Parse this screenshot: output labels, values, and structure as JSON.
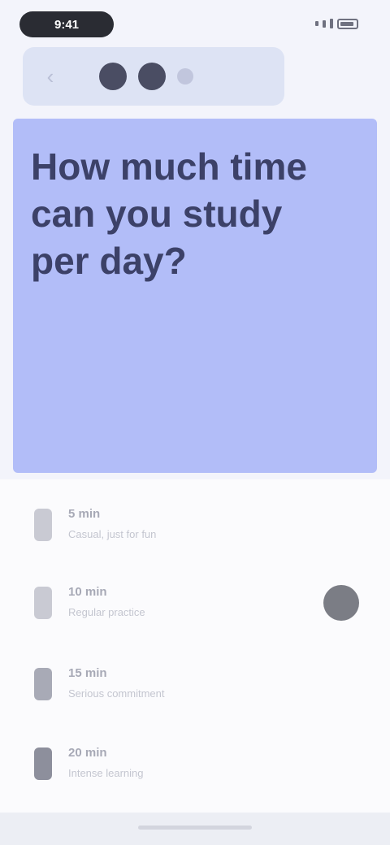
{
  "status_bar": {
    "time": "9:41"
  },
  "header": {
    "back_icon": "chevron-left-icon",
    "step_label": "..."
  },
  "question": {
    "title": "How much time can you study per day?"
  },
  "options": [
    {
      "label": "5 min",
      "desc": "Casual, just for fun",
      "selected": false
    },
    {
      "label": "10 min",
      "desc": "Regular practice",
      "selected": true
    },
    {
      "label": "15 min",
      "desc": "Serious commitment",
      "selected": false
    },
    {
      "label": "20 min",
      "desc": "Intense learning",
      "selected": false
    }
  ],
  "colors": {
    "accent": "#b2bdf8",
    "header_bg": "#dde3f4",
    "title_text": "#3c4168",
    "selected_radio": "#7b7d85"
  }
}
